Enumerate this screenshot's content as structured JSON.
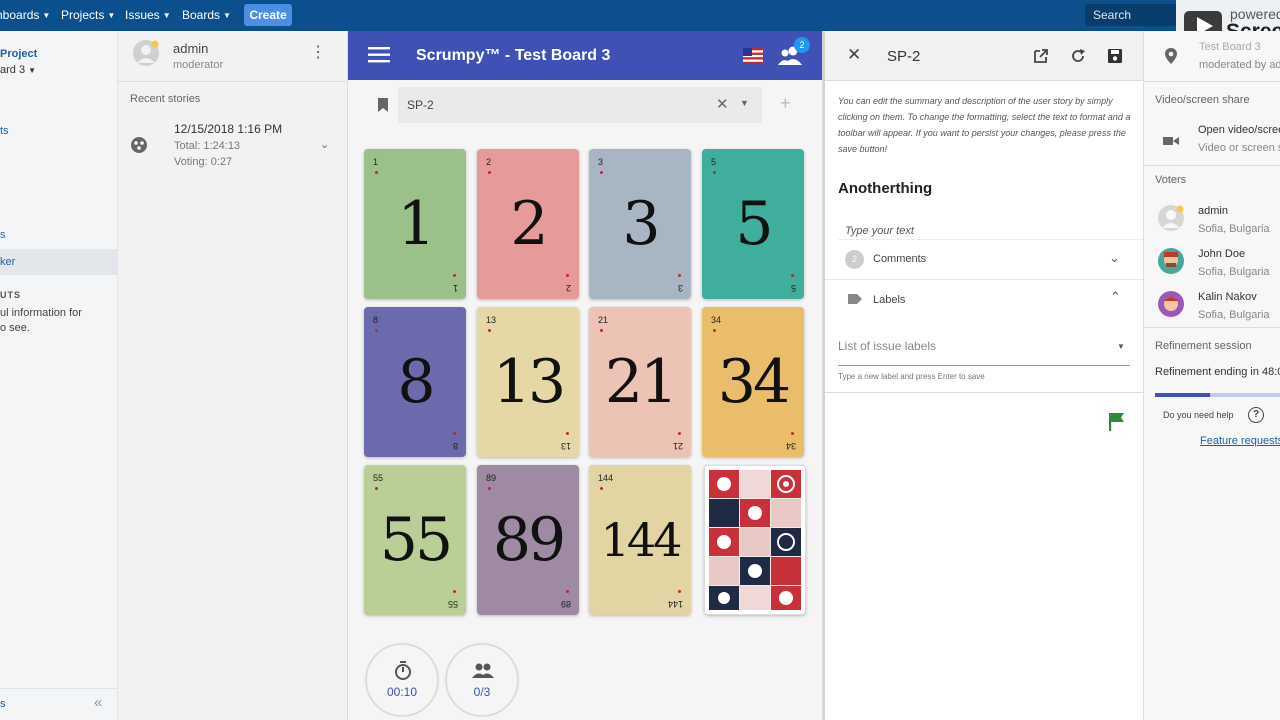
{
  "jira_nav": {
    "items": [
      {
        "label": "hboards"
      },
      {
        "label": "Projects"
      },
      {
        "label": "Issues"
      },
      {
        "label": "Boards"
      }
    ],
    "create_label": "Create",
    "search_placeholder": "Search"
  },
  "watermark": {
    "line1": "powered",
    "line2": "Scree"
  },
  "jira_sidebar": {
    "project": "Project",
    "board": "ard 3",
    "link1": "ts",
    "link2": "s",
    "link3": "ker",
    "section": "UTS",
    "info1": "ul information for",
    "info2": "o see.",
    "bottom": "s",
    "collapse": "«"
  },
  "user_panel": {
    "name": "admin",
    "role": "moderator",
    "recent_title": "Recent stories",
    "story": {
      "date": "12/15/2018 1:16 PM",
      "total": "Total: 1:24:13",
      "voting": "Voting: 0:27"
    }
  },
  "board": {
    "title": "Scrumpy™ - Test Board 3",
    "participants_badge": "2",
    "story_key": "SP-2",
    "cards": [
      {
        "value": "1",
        "bg": "#9cc08a"
      },
      {
        "value": "2",
        "bg": "#e79a9a"
      },
      {
        "value": "3",
        "bg": "#a7b6c2"
      },
      {
        "value": "5",
        "bg": "#3fae9c"
      },
      {
        "value": "8",
        "bg": "#6b6aad"
      },
      {
        "value": "13",
        "bg": "#e6d7a6"
      },
      {
        "value": "21",
        "bg": "#edc3b5"
      },
      {
        "value": "34",
        "bg": "#e9bd6a"
      },
      {
        "value": "55",
        "bg": "#b9cf96"
      },
      {
        "value": "89",
        "bg": "#9e8aa2"
      },
      {
        "value": "144",
        "bg": "#e2d4a3"
      }
    ],
    "timer": "00:10",
    "votes": "0/3"
  },
  "detail": {
    "title": "SP-2",
    "hint": "You can edit the summary and description of the user story by simply clicking on them. To change the formatting, select the text to format and a toolbar will appear. If you want to persist your changes, please press the save button!",
    "summary": "Anotherthing",
    "description_placeholder": "Type your text",
    "comments_count": "2",
    "comments_label": "Comments",
    "labels_label": "Labels",
    "labels_placeholder": "List of issue labels",
    "labels_hint": "Type a new label and press Enter to save"
  },
  "right_panel": {
    "board_name": "Test Board 3",
    "moderated_by": "moderated by adr",
    "video_title": "Video/screen share",
    "video_action": "Open video/scree",
    "video_sub": "Video or screen s",
    "voters_title": "Voters",
    "voters": [
      {
        "name": "admin",
        "location": "Sofia, Bulgaria"
      },
      {
        "name": "John Doe",
        "location": "Sofia, Bulgaria"
      },
      {
        "name": "Kalin Nakov",
        "location": "Sofia, Bulgaria"
      }
    ],
    "refinement_title": "Refinement session",
    "refinement_text": "Refinement ending in 48:0",
    "refinement_progress": 0.44,
    "help_text": "Do you need help",
    "feature_link": "Feature requests"
  }
}
